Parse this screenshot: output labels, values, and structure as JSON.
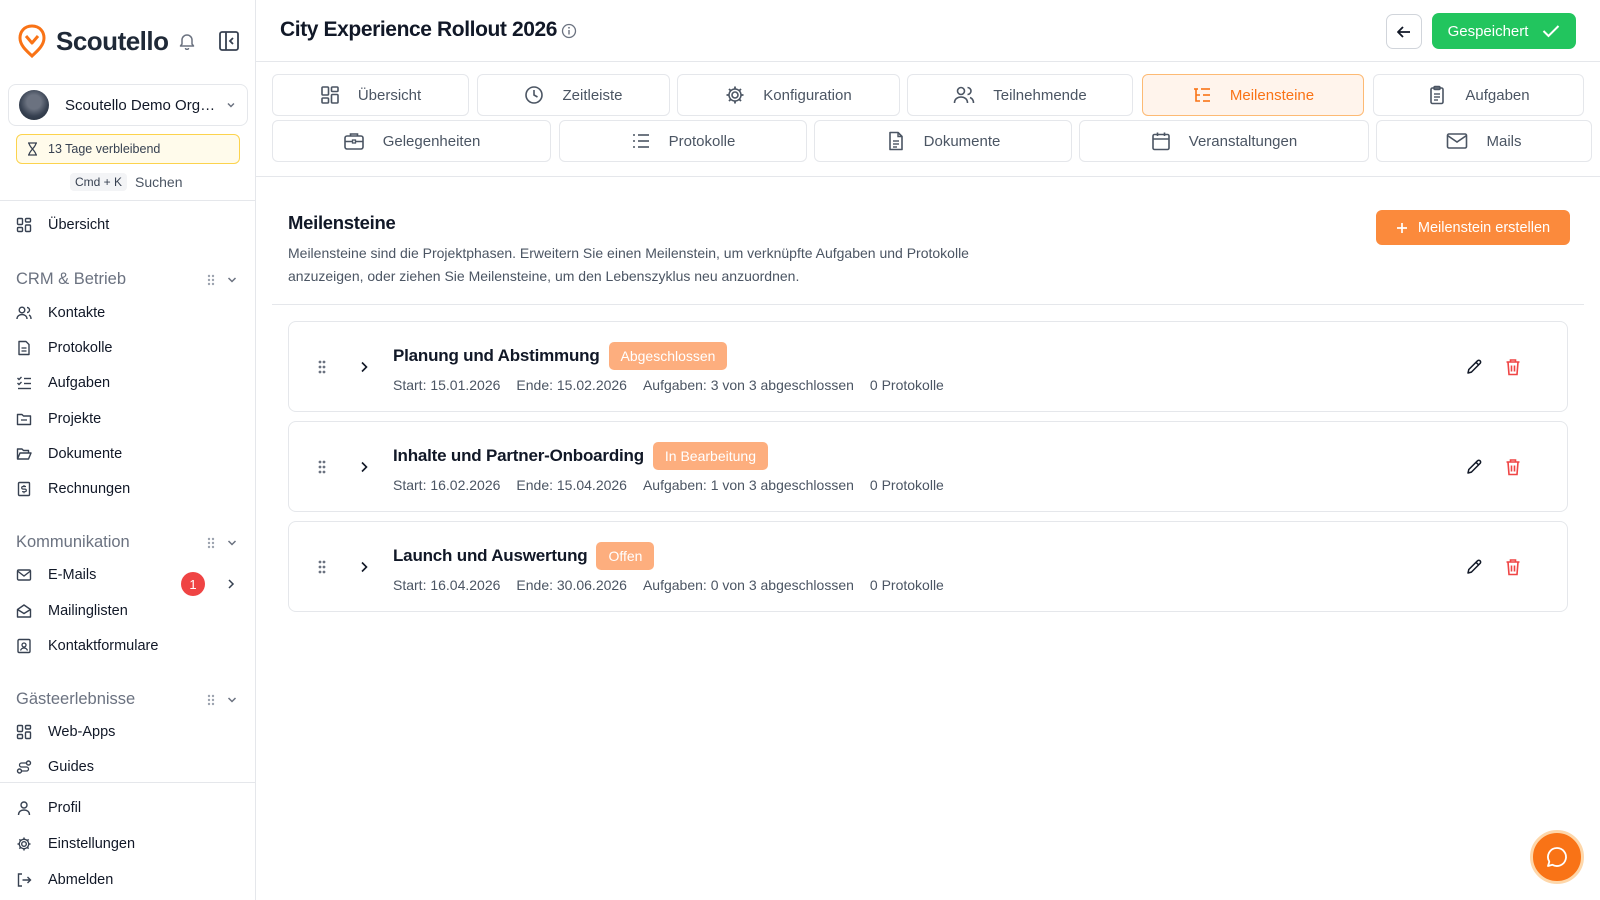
{
  "brand": {
    "name": "Scoutello"
  },
  "org": {
    "name": "Scoutello Demo Organisation"
  },
  "trial": {
    "text": "13 Tage verbleibend"
  },
  "search": {
    "shortcut": "Cmd + K",
    "label": "Suchen"
  },
  "sidebar": {
    "overview": "Übersicht",
    "sections": {
      "crm": {
        "title": "CRM & Betrieb",
        "items": [
          "Kontakte",
          "Protokolle",
          "Aufgaben",
          "Projekte",
          "Dokumente",
          "Rechnungen"
        ]
      },
      "comm": {
        "title": "Kommunikation",
        "items": [
          "E-Mails",
          "Mailinglisten",
          "Kontaktformulare"
        ],
        "email_badge": "1"
      },
      "guest": {
        "title": "Gästeerlebnisse",
        "items": [
          "Web-Apps",
          "Guides"
        ]
      }
    },
    "bottom": [
      "Profil",
      "Einstellungen",
      "Abmelden"
    ]
  },
  "header": {
    "title": "City Experience Rollout 2026",
    "saved_label": "Gespeichert"
  },
  "tabs": [
    {
      "label": "Übersicht",
      "icon": "grid-icon",
      "active": false
    },
    {
      "label": "Zeitleiste",
      "icon": "clock-icon",
      "active": false
    },
    {
      "label": "Konfiguration",
      "icon": "gear-icon",
      "active": false
    },
    {
      "label": "Teilnehmende",
      "icon": "users-icon",
      "active": false
    },
    {
      "label": "Meilensteine",
      "icon": "list-tree-icon",
      "active": true
    },
    {
      "label": "Aufgaben",
      "icon": "clipboard-icon",
      "active": false
    },
    {
      "label": "Gelegenheiten",
      "icon": "briefcase-icon",
      "active": false
    },
    {
      "label": "Protokolle",
      "icon": "list-icon",
      "active": false
    },
    {
      "label": "Dokumente",
      "icon": "file-icon",
      "active": false
    },
    {
      "label": "Veranstaltungen",
      "icon": "calendar-icon",
      "active": false
    },
    {
      "label": "Mails",
      "icon": "mail-icon",
      "active": false
    }
  ],
  "milestones_section": {
    "title": "Meilensteine",
    "description": "Meilensteine sind die Projektphasen. Erweitern Sie einen Meilenstein, um verknüpfte Aufgaben und Protokolle anzuzeigen, oder ziehen Sie Meilensteine, um den Lebenszyklus neu anzuordnen.",
    "create_label": "Meilenstein erstellen"
  },
  "milestones": [
    {
      "name": "Planung und Abstimmung",
      "status": "Abgeschlossen",
      "start": "Start: 15.01.2026",
      "end": "Ende: 15.02.2026",
      "tasks": "Aufgaben: 3 von 3 abgeschlossen",
      "protocols": "0 Protokolle"
    },
    {
      "name": "Inhalte und Partner-Onboarding",
      "status": "In Bearbeitung",
      "start": "Start: 16.02.2026",
      "end": "Ende: 15.04.2026",
      "tasks": "Aufgaben: 1 von 3 abgeschlossen",
      "protocols": "0 Protokolle"
    },
    {
      "name": "Launch und Auswertung",
      "status": "Offen",
      "start": "Start: 16.04.2026",
      "end": "Ende: 30.06.2026",
      "tasks": "Aufgaben: 0 von 3 abgeschlossen",
      "protocols": "0 Protokolle"
    }
  ],
  "colors": {
    "accent": "#f97316",
    "success": "#22c55e",
    "danger": "#ef4444"
  }
}
